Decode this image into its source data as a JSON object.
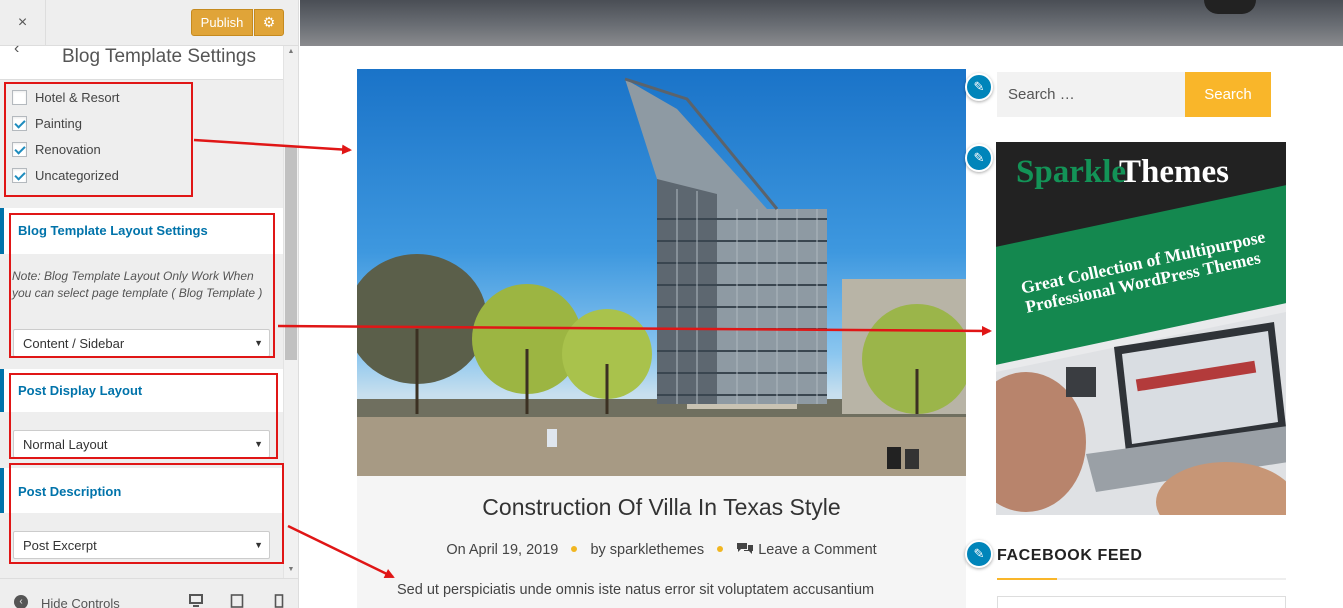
{
  "customizer": {
    "close_icon": "×",
    "publish_label": "Publish",
    "gear_icon": "⚙",
    "back_icon": "‹",
    "section_title": "Blog Template Settings",
    "categories": [
      {
        "label": "Hotel & Resort",
        "checked": false
      },
      {
        "label": "Painting",
        "checked": true
      },
      {
        "label": "Renovation",
        "checked": true
      },
      {
        "label": "Uncategorized",
        "checked": true
      }
    ],
    "layout_settings": {
      "title": "Blog Template Layout Settings",
      "note": "Note: Blog Template Layout Only Work When you can select page template ( Blog Template )",
      "selected": "Content / Sidebar"
    },
    "post_display": {
      "title": "Post Display Layout",
      "selected": "Normal Layout"
    },
    "post_description": {
      "title": "Post Description",
      "selected": "Post Excerpt"
    },
    "footer": {
      "hide_controls": "Hide Controls"
    },
    "accent_color": "#0073aa",
    "annotation_color": "#e01616"
  },
  "preview": {
    "post": {
      "title": "Construction Of Villa In Texas Style",
      "date_prefix": "On",
      "date": "April 19, 2019",
      "author_prefix": "by",
      "author": "sparklethemes",
      "comments": "Leave a Comment",
      "excerpt": "Sed ut perspiciatis unde omnis iste natus error sit voluptatem accusantium"
    },
    "search": {
      "placeholder": "Search …",
      "button": "Search"
    },
    "ad": {
      "brand_green": "Sparkle",
      "brand_white": "Themes",
      "tagline_1": "Great Collection of Multipurpose",
      "tagline_2": "Professional WordPress Themes"
    },
    "facebook_title": "FACEBOOK FEED",
    "accent_color": "#f9b62a"
  }
}
